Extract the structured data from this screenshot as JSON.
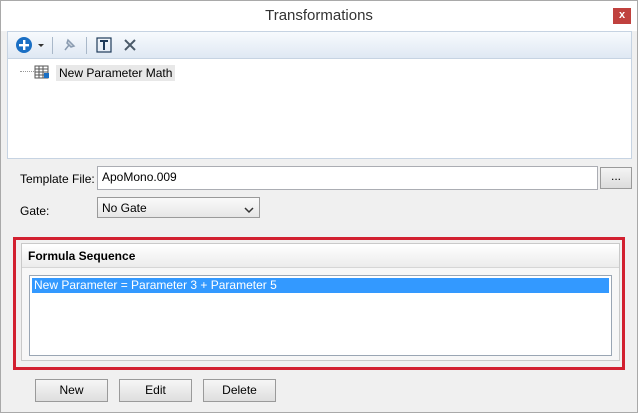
{
  "window": {
    "title": "Transformations",
    "close_label": "x"
  },
  "toolbar": {
    "items": [
      {
        "icon": "add-icon"
      },
      {
        "icon": "dropdown-arrow-icon"
      },
      {
        "icon": "pin-icon"
      },
      {
        "icon": "text-icon"
      },
      {
        "icon": "delete-icon"
      }
    ]
  },
  "tree": {
    "items": [
      {
        "label": "New Parameter Math",
        "icon": "grid-table-icon"
      }
    ]
  },
  "template": {
    "label": "Template File:",
    "value": "ApoMono.009",
    "browse_label": "..."
  },
  "gate": {
    "label": "Gate:",
    "value": "No Gate"
  },
  "formula": {
    "header": "Formula Sequence",
    "items": [
      "New Parameter = Parameter 3 + Parameter 5"
    ]
  },
  "buttons": {
    "new": "New",
    "edit": "Edit",
    "delete": "Delete"
  },
  "colors": {
    "highlight_frame": "#d22030",
    "selection": "#3399ff",
    "close_button": "#c0413e"
  }
}
